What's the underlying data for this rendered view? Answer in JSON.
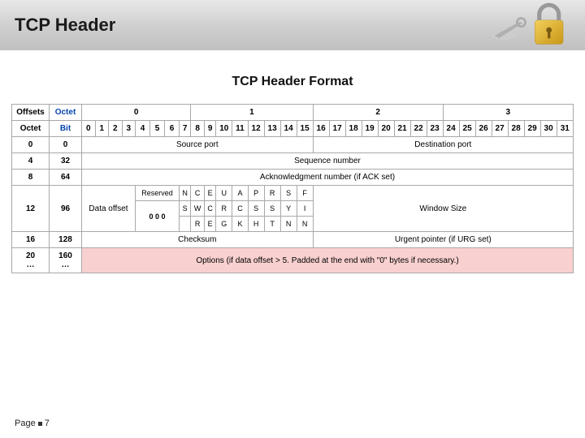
{
  "title": "TCP Header",
  "subtitle": "TCP Header Format",
  "page_label_prefix": "Page",
  "page_number": "7",
  "table": {
    "header_row1": {
      "offsets": "Offsets",
      "octet_link": "Octet",
      "group0": "0",
      "group1": "1",
      "group2": "2",
      "group3": "3"
    },
    "header_row2": {
      "octet": "Octet",
      "bit": "Bit",
      "bits": [
        "0",
        "1",
        "2",
        "3",
        "4",
        "5",
        "6",
        "7",
        "8",
        "9",
        "10",
        "11",
        "12",
        "13",
        "14",
        "15",
        "16",
        "17",
        "18",
        "19",
        "20",
        "21",
        "22",
        "23",
        "24",
        "25",
        "26",
        "27",
        "28",
        "29",
        "30",
        "31"
      ]
    },
    "rows": [
      {
        "octet": "0",
        "bit": "0",
        "fields": [
          {
            "span": 16,
            "label": "Source port"
          },
          {
            "span": 16,
            "label": "Destination port"
          }
        ]
      },
      {
        "octet": "4",
        "bit": "32",
        "fields": [
          {
            "span": 32,
            "label": "Sequence number"
          }
        ]
      },
      {
        "octet": "8",
        "bit": "64",
        "fields": [
          {
            "span": 32,
            "label": "Acknowledgment number (if ACK set)"
          }
        ]
      },
      {
        "octet": "12",
        "bit": "96",
        "data_offset": "Data offset",
        "reserved_label": "Reserved",
        "reserved_zeros": "0 0 0",
        "flag_col": [
          "N",
          "S"
        ],
        "flags": [
          [
            "C",
            "W",
            "R"
          ],
          [
            "E",
            "C",
            "E"
          ],
          [
            "U",
            "R",
            "G"
          ],
          [
            "A",
            "C",
            "K"
          ],
          [
            "P",
            "S",
            "H"
          ],
          [
            "R",
            "S",
            "T"
          ],
          [
            "S",
            "Y",
            "N"
          ],
          [
            "F",
            "I",
            "N"
          ]
        ],
        "window": "Window Size"
      },
      {
        "octet": "16",
        "bit": "128",
        "fields": [
          {
            "span": 16,
            "label": "Checksum"
          },
          {
            "span": 16,
            "label": "Urgent pointer (if URG set)"
          }
        ]
      },
      {
        "octet": "20\n…",
        "bit": "160\n…",
        "options": "Options (if data offset > 5. Padded at the end with \"0\" bytes if necessary.)",
        "pink": true
      }
    ]
  }
}
